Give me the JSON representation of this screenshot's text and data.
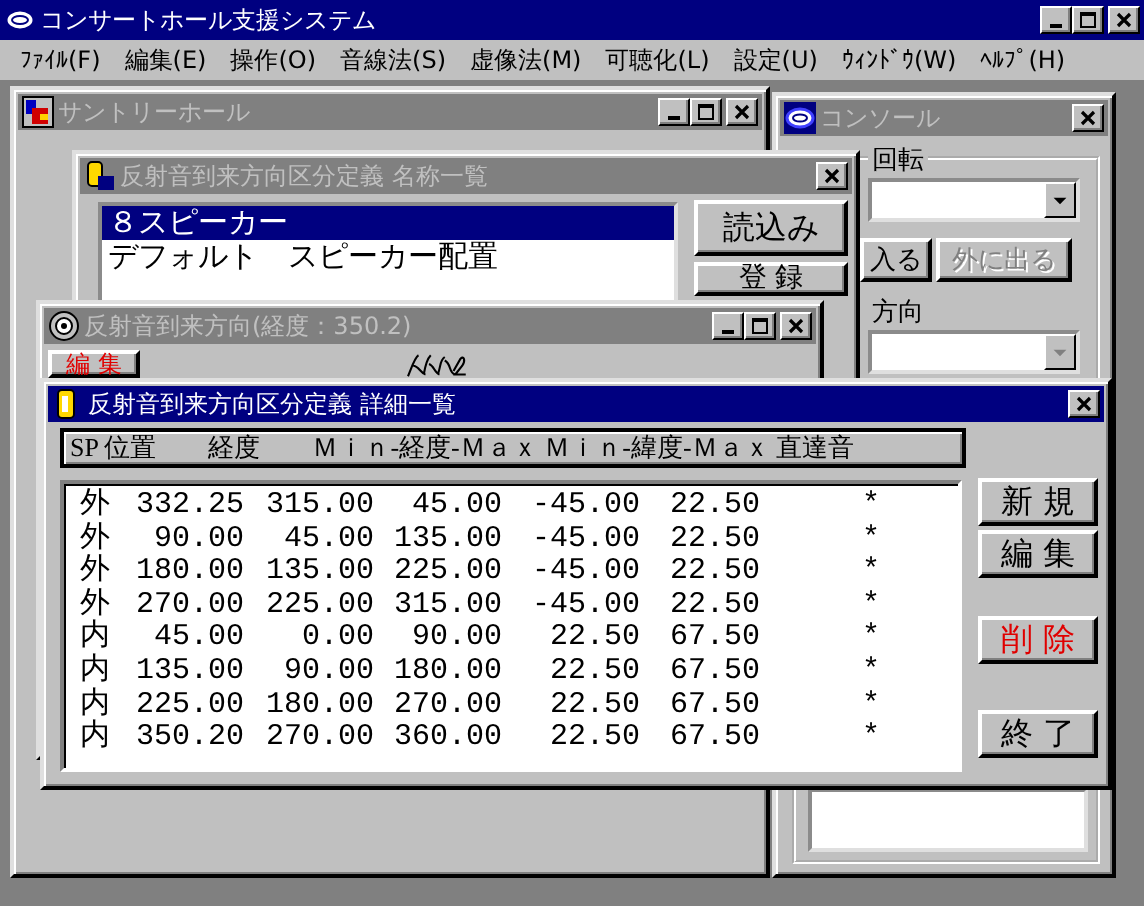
{
  "app": {
    "title": "コンサートホール支援システム",
    "active": true
  },
  "menu": [
    "ﾌｧｲﾙ(F)",
    "編集(E)",
    "操作(O)",
    "音線法(S)",
    "虚像法(M)",
    "可聴化(L)",
    "設定(U)",
    "ｳｨﾝﾄﾞｳ(W)",
    "ﾍﾙﾌﾟ(H)"
  ],
  "hall_window": {
    "title": "サントリーホール",
    "active": false
  },
  "console_window": {
    "title": "コンソール",
    "active": false,
    "rotation_label": "回転",
    "rotation_dropdown": {
      "disabled": false
    },
    "buttons": [
      {
        "label": "入る",
        "disabled": false
      },
      {
        "label": "外に出る",
        "disabled": true
      }
    ],
    "direction_label": "方向",
    "direction_dropdown": {
      "disabled": true
    }
  },
  "name_list_window": {
    "title": "反射音到来方向区分定義 名称一覧",
    "active": false,
    "items": [
      {
        "label": "８スピーカー",
        "selected": true
      },
      {
        "label": "デフォルト　スピーカー配置",
        "selected": false
      }
    ],
    "buttons": [
      "読込み",
      "登 録"
    ]
  },
  "direction_window": {
    "title": "反射音到来方向(経度：350.2)",
    "active": false,
    "edit_button": {
      "label": "編 集",
      "kind": "danger"
    }
  },
  "detail_window": {
    "title": "反射音到来方向区分定義 詳細一覧",
    "active": true,
    "header_text": "SP 位置　　経度　　Ｍｉｎ-経度-Ｍａｘ Ｍｉｎ-緯度-Ｍａｘ 直達音",
    "rows": [
      [
        "外",
        "332.25",
        "315.00",
        "45.00",
        "-45.00",
        "22.50",
        "*"
      ],
      [
        "外",
        "90.00",
        "45.00",
        "135.00",
        "-45.00",
        "22.50",
        "*"
      ],
      [
        "外",
        "180.00",
        "135.00",
        "225.00",
        "-45.00",
        "22.50",
        "*"
      ],
      [
        "外",
        "270.00",
        "225.00",
        "315.00",
        "-45.00",
        "22.50",
        "*"
      ],
      [
        "内",
        "45.00",
        "0.00",
        "90.00",
        "22.50",
        "67.50",
        "*"
      ],
      [
        "内",
        "135.00",
        "90.00",
        "180.00",
        "22.50",
        "67.50",
        "*"
      ],
      [
        "内",
        "225.00",
        "180.00",
        "270.00",
        "22.50",
        "67.50",
        "*"
      ],
      [
        "内",
        "350.20",
        "270.00",
        "360.00",
        "22.50",
        "67.50",
        "*"
      ]
    ],
    "buttons": [
      {
        "label": "新 規",
        "kind": "normal"
      },
      {
        "label": "編 集",
        "kind": "normal"
      },
      {
        "label": "削 除",
        "kind": "danger"
      },
      {
        "label": "終 了",
        "kind": "normal"
      }
    ]
  }
}
